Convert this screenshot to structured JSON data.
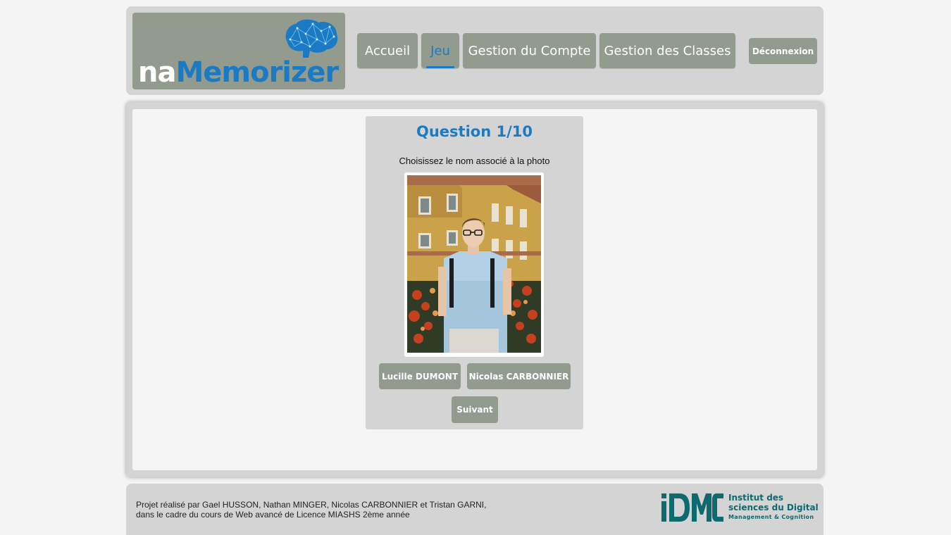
{
  "header": {
    "logo": {
      "part1": "na",
      "part2": "Memorizer"
    },
    "nav": [
      {
        "label": "Accueil"
      },
      {
        "label": "Jeu",
        "active": true
      },
      {
        "label": "Gestion du Compte"
      },
      {
        "label": "Gestion des Classes"
      }
    ],
    "logout_label": "Déconnexion"
  },
  "quiz": {
    "title": "Question 1/10",
    "instruction": "Choisissez le nom associé à la photo",
    "answers": [
      "Lucille DUMONT",
      "Nicolas CARBONNIER"
    ],
    "next_label": "Suivant"
  },
  "footer": {
    "line1": "Projet réalisé par Gael HUSSON, Nathan MINGER, Nicolas CARBONNIER et Tristan GARNI,",
    "line2": "dans le cadre du cours de Web avancé de Licence MIASHS 2ème année",
    "idmc_line1": "Institut des",
    "idmc_line2": "sciences du Digital",
    "idmc_line3": "Management & Cognition"
  },
  "colors": {
    "accent": "#1a7bc4",
    "button": "#939a8e",
    "panel": "#d4d4d4",
    "idmc": "#0e6a6f"
  }
}
